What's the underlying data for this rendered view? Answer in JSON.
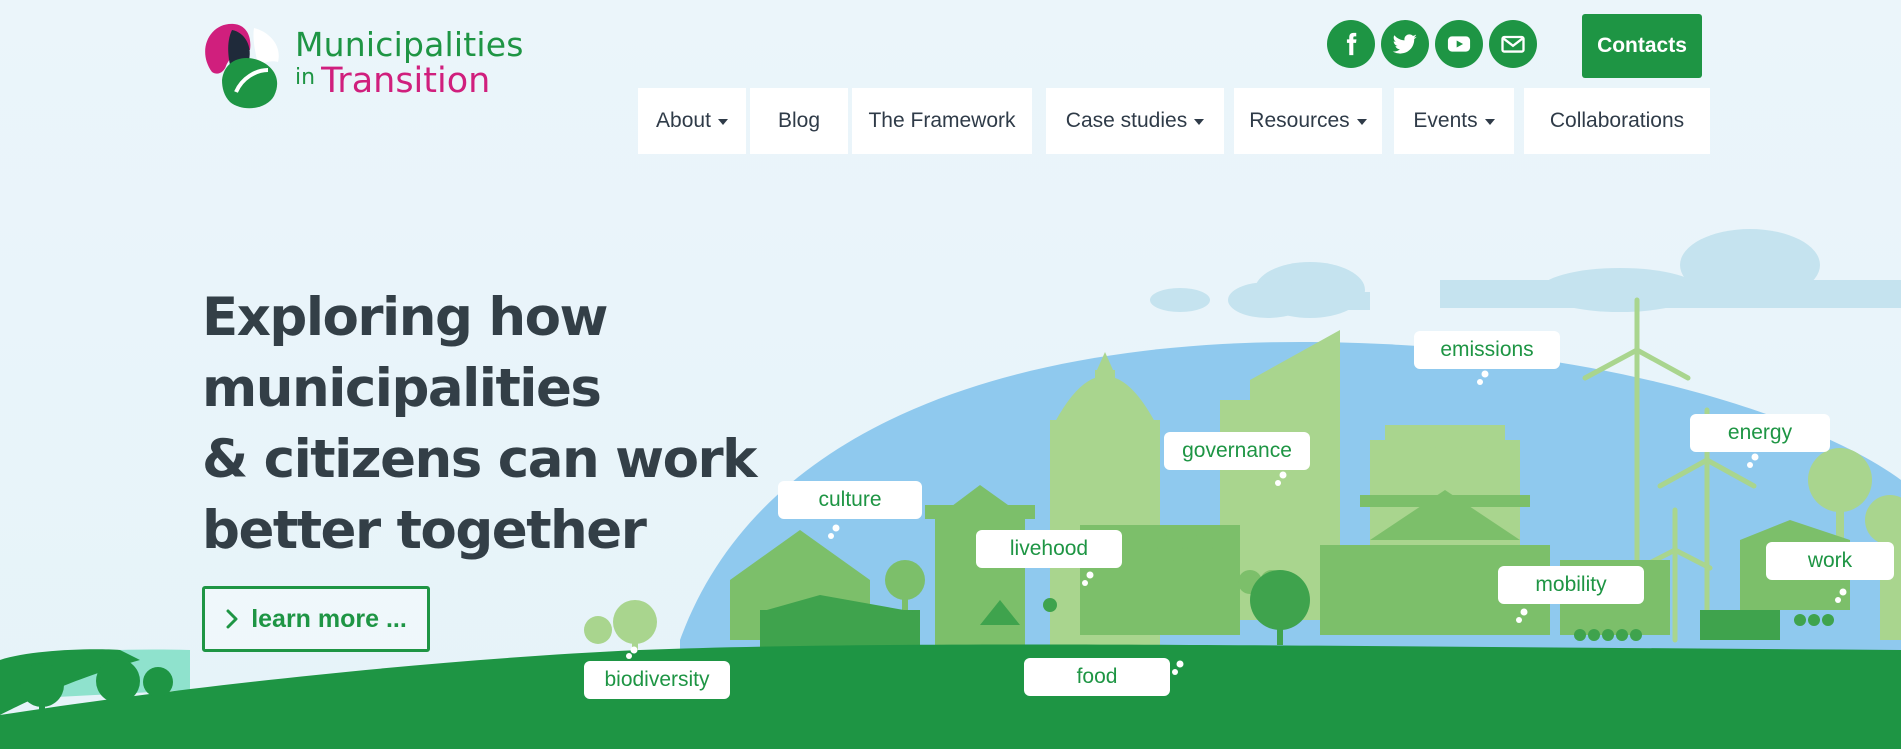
{
  "logo": {
    "line1": "Municipalities",
    "line2_prefix": "in",
    "line2_word": "Transition"
  },
  "social": [
    {
      "icon": "facebook-icon"
    },
    {
      "icon": "twitter-icon"
    },
    {
      "icon": "youtube-icon"
    },
    {
      "icon": "mail-icon"
    }
  ],
  "header": {
    "contacts_label": "Contacts"
  },
  "nav": {
    "items": [
      {
        "label": "About",
        "dropdown": true
      },
      {
        "label": "Blog",
        "dropdown": false
      },
      {
        "label": "The Framework",
        "dropdown": false
      },
      {
        "label": "Case studies",
        "dropdown": true
      },
      {
        "label": "Resources",
        "dropdown": true
      },
      {
        "label": "Events",
        "dropdown": true
      },
      {
        "label": "Collaborations",
        "dropdown": false
      }
    ]
  },
  "hero": {
    "headline": [
      "Exploring how",
      "municipalities",
      "& citizens can work",
      "better together"
    ],
    "cta_label": "learn more ..."
  },
  "tags": [
    "emissions",
    "energy",
    "governance",
    "culture",
    "livehood",
    "mobility",
    "work",
    "biodiversity",
    "food"
  ],
  "colors": {
    "brand_green": "#1e9544",
    "brand_pink": "#d01f7d",
    "headline": "#333f47",
    "nav_text": "#2f3b48",
    "sky_blue": "#8fc9ee",
    "background": "#ebf5fa"
  }
}
